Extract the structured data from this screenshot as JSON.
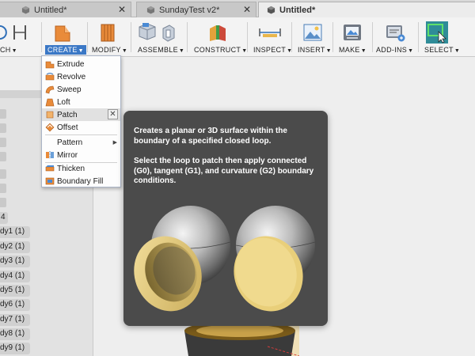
{
  "tabs": [
    {
      "label": "Untitled*",
      "close": "✕"
    },
    {
      "label": "SundayTest v2*",
      "close": "✕"
    },
    {
      "label": "Untitled*",
      "close": "✕"
    }
  ],
  "toolbar": {
    "groups": [
      {
        "label": "CH",
        "icon": "sketch-icon"
      },
      {
        "label": "CREATE",
        "icon": "create-box-icon"
      },
      {
        "label": "MODIFY",
        "icon": "modify-icon"
      },
      {
        "label": "ASSEMBLE",
        "icon": "assemble-icon"
      },
      {
        "label": "CONSTRUCT",
        "icon": "construct-plane-icon"
      },
      {
        "label": "INSPECT",
        "icon": "measure-icon"
      },
      {
        "label": "INSERT",
        "icon": "insert-image-icon"
      },
      {
        "label": "MAKE",
        "icon": "make-printer-icon"
      },
      {
        "label": "ADD-INS",
        "icon": "addins-icon"
      },
      {
        "label": "SELECT",
        "icon": "select-arrow-icon"
      }
    ],
    "caret": "▼",
    "accent": "#3b78c6"
  },
  "create_menu": {
    "items": [
      {
        "label": "Extrude",
        "icon": "extrude-icon"
      },
      {
        "label": "Revolve",
        "icon": "revolve-icon"
      },
      {
        "label": "Sweep",
        "icon": "sweep-icon"
      },
      {
        "label": "Loft",
        "icon": "loft-icon"
      },
      {
        "label": "Patch",
        "icon": "patch-icon",
        "highlighted": true
      },
      {
        "label": "Offset",
        "icon": "offset-icon"
      },
      {
        "label": "Pattern",
        "icon": "pattern-icon",
        "submenu": "▶"
      },
      {
        "label": "Mirror",
        "icon": "mirror-icon"
      },
      {
        "label": "Thicken",
        "icon": "thicken-icon"
      },
      {
        "label": "Boundary Fill",
        "icon": "boundary-fill-icon"
      }
    ],
    "pin": "✕"
  },
  "tooltip": {
    "summary": "Creates a planar or 3D surface within the boundary of a specified closed loop.",
    "detail": "Select the loop to patch then apply connected (G0), tangent (G1), and curvature (G2) boundary conditions."
  },
  "browser": {
    "count_label": "4",
    "bodies": [
      "dy1 (1)",
      "dy2 (1)",
      "dy3 (1)",
      "dy4 (1)",
      "dy5 (1)",
      "dy6 (1)",
      "dy7 (1)",
      "dy8 (1)",
      "dy9 (1)"
    ]
  }
}
